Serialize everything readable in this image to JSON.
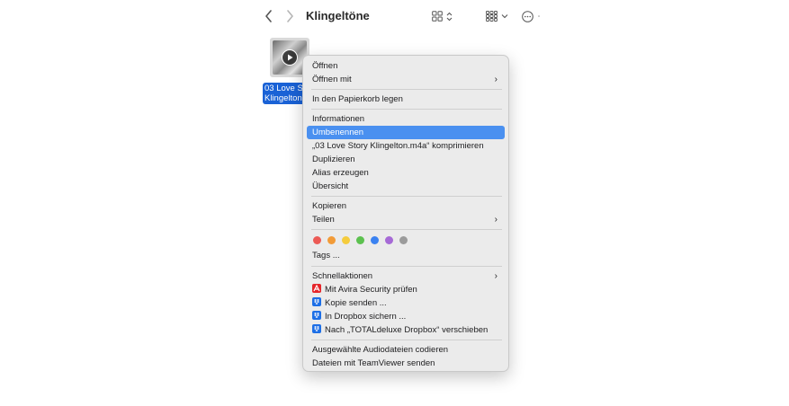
{
  "toolbar": {
    "title": "Klingeltöne",
    "back_icon": "chevron-left-icon",
    "forward_icon": "chevron-right-icon",
    "view_icon": "icon-grid-icon",
    "group_icon": "group-grid-icon",
    "action_icon": "ellipsis-circle-icon"
  },
  "file": {
    "name_line1": "03 Love St",
    "name_line2": "Klingelton.",
    "selection_color": "#1a62d6"
  },
  "menu": {
    "highlight_color": "#4a90f0",
    "items": {
      "open": "Öffnen",
      "open_with": "Öffnen mit",
      "trash": "In den Papierkorb legen",
      "info": "Informationen",
      "rename": "Umbenennen",
      "compress": "„03 Love Story Klingelton.m4a“ komprimieren",
      "duplicate": "Duplizieren",
      "alias": "Alias erzeugen",
      "quicklook": "Übersicht",
      "copy": "Kopieren",
      "share": "Teilen",
      "tags": "Tags ...",
      "quick_actions": "Schnellaktionen",
      "avira": "Mit Avira Security prüfen",
      "dropbox_send": "Kopie senden ...",
      "dropbox_save": "In Dropbox sichern ...",
      "dropbox_move": "Nach „TOTALdeluxe Dropbox“ verschieben",
      "encode": "Ausgewählte Audiodateien codieren",
      "teamviewer": "Dateien mit TeamViewer senden"
    },
    "submenu_chevron": "›",
    "tag_colors": [
      "#ec5a55",
      "#f29b38",
      "#f5cc3d",
      "#5cc14f",
      "#3b82f1",
      "#a66ad6",
      "#9b9b9b"
    ]
  }
}
